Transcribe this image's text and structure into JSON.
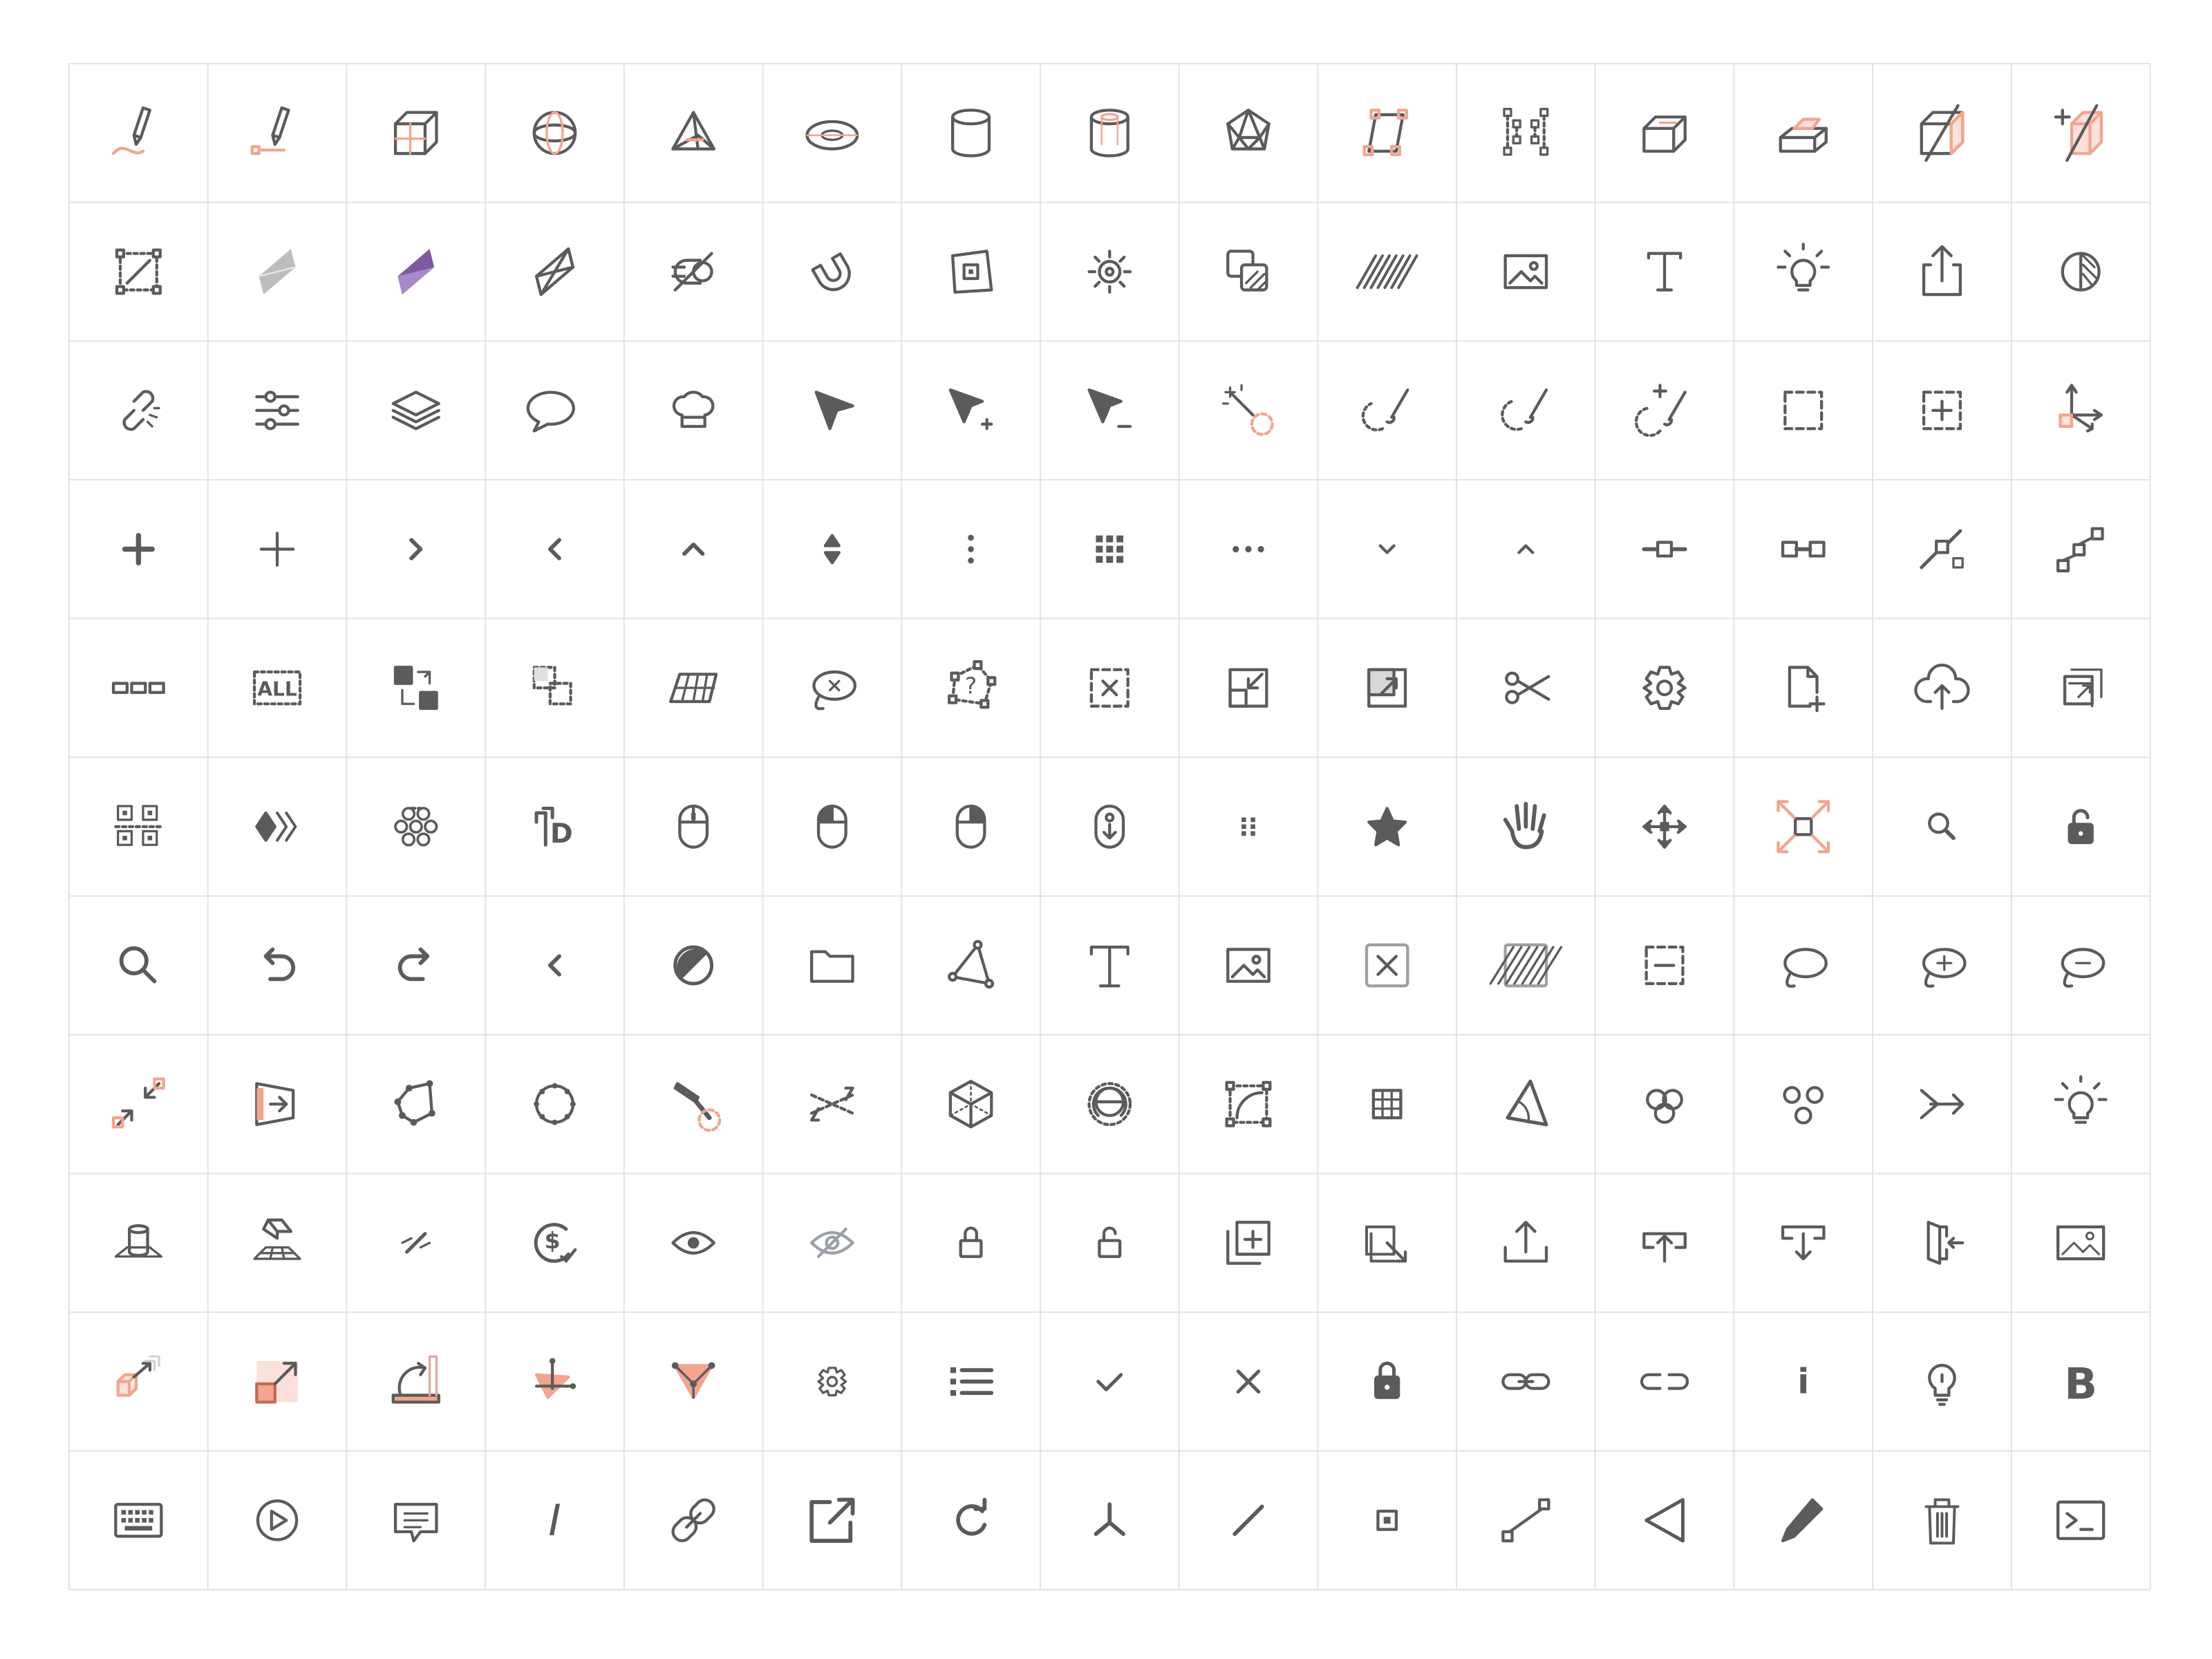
{
  "colors": {
    "stroke": "#5b5b5b",
    "accent": "#f2a58f",
    "accent_fill": "#fbe1d9",
    "grid": "#e3e3e3",
    "purple": "#7d5a9e",
    "gray_fill": "#bdbdbd"
  },
  "grid": {
    "rows": 11,
    "cols": 15
  },
  "rows": [
    [
      "pencil-curve-icon",
      "pencil-point-icon",
      "box-icon",
      "sphere-icon",
      "cone-icon",
      "torus-icon",
      "cylinder-icon",
      "tube-icon",
      "icosahedron-icon",
      "parallelogram-select-icon",
      "points-select-icon",
      "extrude-face-icon",
      "extrude-icon",
      "cut-box-icon",
      "slice-box-icon"
    ],
    [
      "rect-diagonal-select-icon",
      "flat-shading-icon",
      "gradient-shading-icon",
      "wireframe-diamond-icon",
      "snap-off-icon",
      "magnet-icon",
      "align-frame-icon",
      "sun-gear-icon",
      "copy-texture-icon",
      "hatch-icon",
      "image-icon",
      "text-icon",
      "light-bulb-icon",
      "share-icon",
      "half-circle-icon"
    ],
    [
      "broken-link-icon",
      "sliders-icon",
      "layers-icon",
      "speech-bubble-icon",
      "chef-hat-icon",
      "cursor-icon",
      "cursor-plus-icon",
      "cursor-minus-icon",
      "magic-wand-icon",
      "lasso-brush-icon",
      "lasso-brush-alt-icon",
      "lasso-brush-plus-icon",
      "dashed-square-icon",
      "dashed-square-plus-icon",
      "axis-gizmo-icon"
    ],
    [
      "plus-bold-icon",
      "plus-icon",
      "chevron-right-icon",
      "chevron-left-icon",
      "chevron-up-icon",
      "sort-icon",
      "vertical-dots-icon",
      "grid-dots-icon",
      "horizontal-dots-icon",
      "chevron-down-icon",
      "chevron-up-small-icon",
      "node-slider-icon",
      "node-link-icon",
      "diagonal-node-icon",
      "steps-node-icon"
    ],
    [
      "dashes-icon",
      "select-all-icon",
      "swap-squares-icon",
      "dashed-overlap-icon",
      "perspective-grid-icon",
      "lasso-remove-icon",
      "help-lasso-icon",
      "dashed-close-icon",
      "shrink-frame-icon",
      "expand-frame-icon",
      "scissors-icon",
      "gear-icon",
      "new-file-icon",
      "cloud-upload-icon",
      "stack-export-icon"
    ],
    [
      "qr-icon",
      "fast-forward-icon",
      "flower-nodes-icon",
      "text-d-icon",
      "mouse-icon",
      "mouse-left-icon",
      "mouse-right-icon",
      "mouse-scroll-icon",
      "drag-dots-icon",
      "star-icon",
      "hand-icon",
      "move-arrows-icon",
      "fullscreen-icon",
      "zoom-icon",
      "unlock-fill-icon"
    ],
    [
      "search-icon",
      "undo-icon",
      "redo-icon",
      "back-icon",
      "contrast-icon",
      "folder-icon",
      "polygon-icon",
      "text-t-icon",
      "picture-icon",
      "close-box-icon",
      "hatch-box-icon",
      "dashed-minus-icon",
      "lasso-icon",
      "lasso-plus-icon",
      "lasso-minus-icon"
    ],
    [
      "collapse-arrows-icon",
      "import-frame-icon",
      "polyline-icon",
      "circle-nodes-icon",
      "hammer-icon",
      "swap-lines-icon",
      "cube-icon",
      "globe-icon",
      "corner-curve-icon",
      "table-grid-icon",
      "angle-icon",
      "circles-icon",
      "three-dots-icon",
      "merge-arrow-icon",
      "bulb-rays-icon"
    ],
    [
      "cylinder-base-icon",
      "eraser-plane-icon",
      "line-slash-icon",
      "dollar-check-icon",
      "eye-icon",
      "eye-off-icon",
      "lock-icon",
      "unlock-icon",
      "add-copy-icon",
      "export-copy-icon",
      "upload-icon",
      "upload-tray-icon",
      "download-tray-icon",
      "exit-icon",
      "landscape-icon"
    ],
    [
      "scale-cube-icon",
      "scale-square-icon",
      "rotate-plane-icon",
      "vertex-triangle-icon",
      "triangle-nodes-icon",
      "small-gear-icon",
      "list-icon",
      "check-icon",
      "x-icon",
      "lock-fill-icon",
      "link-icon",
      "unlink-icon",
      "info-icon",
      "bulb-icon",
      "bold-icon"
    ],
    [
      "keyboard-icon",
      "play-circle-icon",
      "comment-icon",
      "italic-icon",
      "chain-link-icon",
      "external-link-icon",
      "refresh-icon",
      "tripod-icon",
      "line-icon",
      "center-point-icon",
      "segment-icon",
      "triangle-left-icon",
      "pen-icon",
      "trash-icon",
      "terminal-icon"
    ]
  ],
  "labels": {
    "text_T": "T",
    "all": "ALL",
    "dollar": "$",
    "letter_d": "D",
    "question": "?",
    "info_i": "i",
    "bold_b": "B",
    "italic_i": "I"
  }
}
